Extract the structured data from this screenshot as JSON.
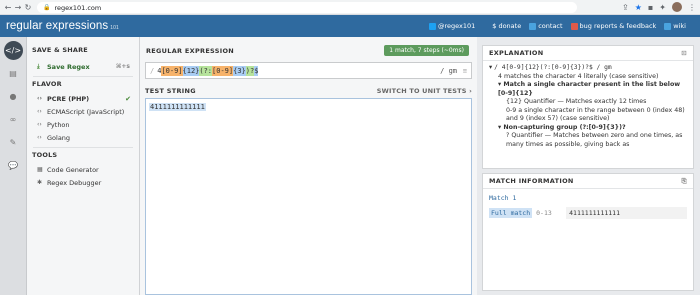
{
  "browser": {
    "url": "regex101.com"
  },
  "topbar": {
    "logo": "regular expressions",
    "logo_suffix": "101",
    "links": [
      {
        "label": "@regex101",
        "icon": "twitter-icon",
        "color": "#1da1f2"
      },
      {
        "label": "$ donate",
        "icon": "donate-icon",
        "color": ""
      },
      {
        "label": "contact",
        "icon": "contact-icon",
        "color": "#4aa3df"
      },
      {
        "label": "bug reports & feedback",
        "icon": "bug-icon",
        "color": "#e05a4a"
      },
      {
        "label": "wiki",
        "icon": "wiki-icon",
        "color": "#4aa3df"
      }
    ]
  },
  "sidebar": {
    "save_share": "SAVE & SHARE",
    "save_regex": "Save Regex",
    "save_shortcut": "⌘+s",
    "flavor": "FLAVOR",
    "flavors": [
      "PCRE (PHP)",
      "ECMAScript (JavaScript)",
      "Python",
      "Golang"
    ],
    "tools": "TOOLS",
    "tool_items": [
      "Code Generator",
      "Regex Debugger"
    ]
  },
  "main": {
    "regex_label": "REGULAR EXPRESSION",
    "match_info": "1 match, 7 steps (~0ms)",
    "delim_open": "/",
    "regex_tokens": [
      {
        "t": "4",
        "c": ""
      },
      {
        "t": "[0-9]",
        "c": "c-or"
      },
      {
        "t": "{12}",
        "c": "c-bl"
      },
      {
        "t": "(?:",
        "c": "c-gr"
      },
      {
        "t": "[0-9]",
        "c": "c-or"
      },
      {
        "t": "{3}",
        "c": "c-bl"
      },
      {
        "t": ")?",
        "c": "c-gr"
      },
      {
        "t": "$",
        "c": "c-bl"
      }
    ],
    "flags": "/ gm",
    "test_label": "TEST STRING",
    "switch_label": "SWITCH TO UNIT TESTS ›",
    "test_string": "4111111111111"
  },
  "explanation": {
    "title": "EXPLANATION",
    "regex_line": "/ 4[0-9]{12}(?:[0-9]{3})?$ / gm",
    "line1": "4 matches the character 4 literally (case sensitive)",
    "line2": "Match a single character present in the list below [0-9]{12}",
    "line3": "{12} Quantifier — Matches exactly 12 times",
    "line4": "0-9 a single character in the range between 0 (index 48) and 9 (index 57) (case sensitive)",
    "line5": "Non-capturing group (?:[0-9]{3})?",
    "line6": "? Quantifier — Matches between zero and one times, as many times as possible, giving back as"
  },
  "match_information": {
    "title": "MATCH INFORMATION",
    "match_label": "Match 1",
    "full_match": "Full match",
    "range": "0-13",
    "value": "4111111111111"
  }
}
